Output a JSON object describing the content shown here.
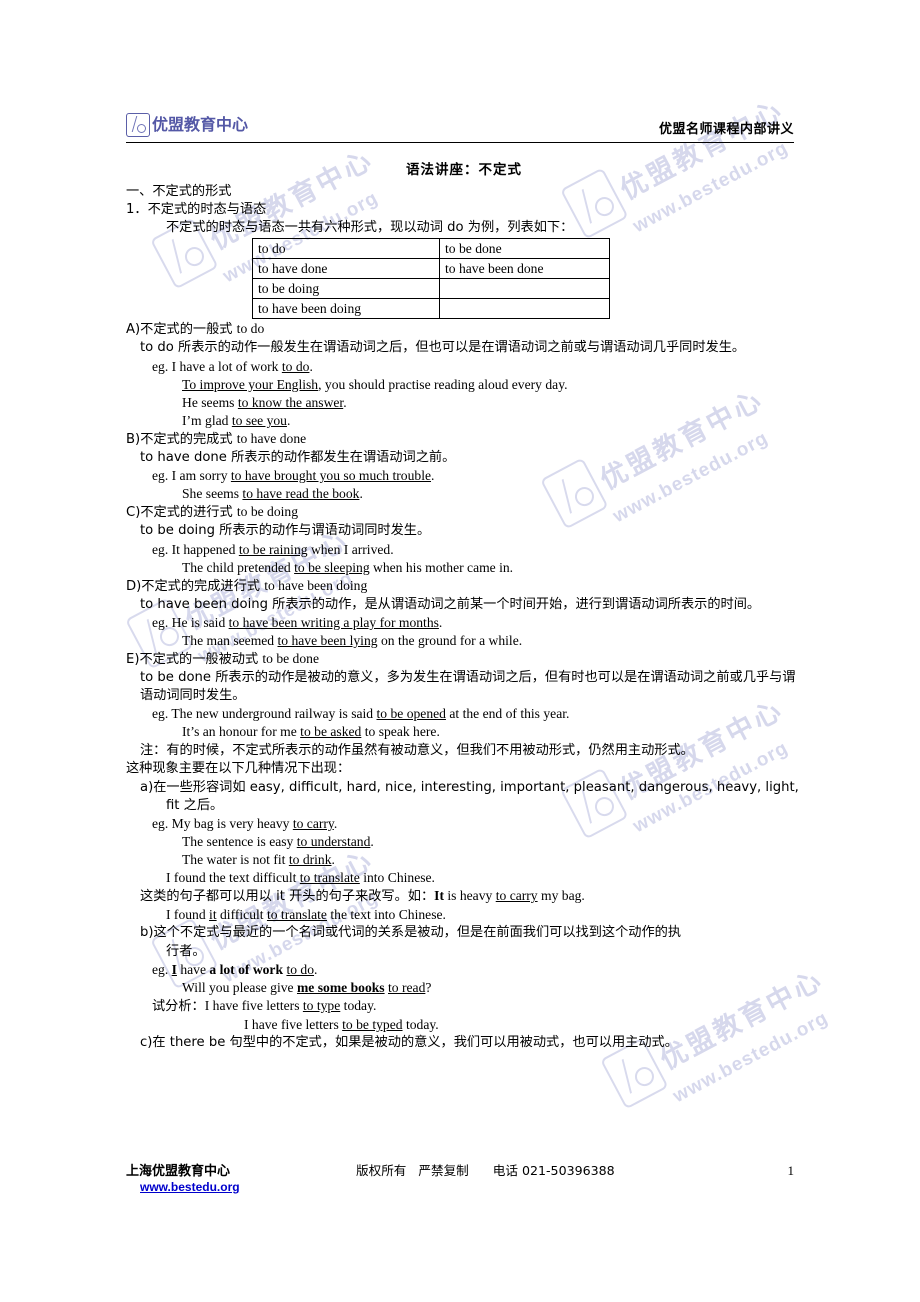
{
  "header": {
    "logo_text": "优盟教育中心",
    "logo_icon": "umeng-logo-icon",
    "right_title": "优盟名师课程内部讲义"
  },
  "doc": {
    "title": "语法讲座：不定式",
    "section1_heading": "一、不定式的形式",
    "item1_heading": "1．不定式的时态与语态",
    "item1_intro": "不定式的时态与语态一共有六种形式，现以动词 do 为例，列表如下：",
    "table": {
      "rows": [
        [
          "to do",
          "to be done"
        ],
        [
          "to have done",
          "to have been done"
        ],
        [
          "to be doing",
          ""
        ],
        [
          "to have been doing",
          ""
        ]
      ]
    },
    "blocks": [
      {
        "heading_cn": "A)不定式的一般式 ",
        "heading_en": "to do",
        "para": "to do 所表示的动作一般发生在谓语动词之后，但也可以是在谓语动词之前或与谓语动词几乎同时发生。",
        "examples": [
          {
            "prefix": "eg. I have a lot of work ",
            "u": "to do",
            "suffix": "."
          },
          {
            "prefix": "",
            "u": "To improve your English",
            "suffix": ", you should practise reading aloud every day."
          },
          {
            "prefix": "He seems ",
            "u": "to know the answer",
            "suffix": "."
          },
          {
            "prefix": "I’m glad ",
            "u": "to see you",
            "suffix": "."
          }
        ]
      },
      {
        "heading_cn": "B)不定式的完成式 ",
        "heading_en": "to have done",
        "para": "to have done 所表示的动作都发生在谓语动词之前。",
        "examples": [
          {
            "prefix": "eg. I am sorry ",
            "u": "to have brought you so much trouble",
            "suffix": "."
          },
          {
            "prefix": "She seems ",
            "u": "to have read the book",
            "suffix": "."
          }
        ]
      },
      {
        "heading_cn": "C)不定式的进行式 ",
        "heading_en": "to be doing",
        "para": "to be doing 所表示的动作与谓语动词同时发生。",
        "examples": [
          {
            "prefix": "eg. It happened ",
            "u": "to be raining",
            "suffix": " when I arrived."
          },
          {
            "prefix": "The child pretended ",
            "u": "to be sleeping",
            "suffix": " when his mother came in."
          }
        ]
      },
      {
        "heading_cn": "D)不定式的完成进行式 ",
        "heading_en": "to have been doing",
        "para": "to have been doing 所表示的动作，是从谓语动词之前某一个时间开始，进行到谓语动词所表示的时间。",
        "examples": [
          {
            "prefix": "eg. He is said ",
            "u": "to have been writing a play for months",
            "suffix": "."
          },
          {
            "prefix": "The man seemed ",
            "u": "to have been lying",
            "suffix": " on the ground for a while."
          }
        ]
      },
      {
        "heading_cn": "E)不定式的一般被动式 ",
        "heading_en": "to be done",
        "para": "to be done 所表示的动作是被动的意义，多为发生在谓语动词之后，但有时也可以是在谓语动词之前或几乎与谓语动词同时发生。",
        "examples": [
          {
            "prefix": "eg. The new underground railway is said ",
            "u": "to be opened",
            "suffix": " at the end of this year."
          },
          {
            "prefix": "It’s an honour for me ",
            "u": "to be asked",
            "suffix": " to speak here."
          }
        ]
      }
    ],
    "note_line1": "注：有的时候，不定式所表示的动作虽然有被动意义，但我们不用被动形式，仍然用主动形式。",
    "note_line2": "这种现象主要在以下几种情况下出现：",
    "sub_a": {
      "line1": "a)在一些形容词如 easy, difficult, hard, nice, interesting, important, pleasant, dangerous, heavy, light,",
      "line2": "fit 之后。",
      "examples": [
        {
          "prefix": "eg. My bag is very heavy ",
          "u": "to carry",
          "suffix": "."
        },
        {
          "prefix": "The sentence is easy ",
          "u": "to understand",
          "suffix": "."
        },
        {
          "prefix": "The water is not fit ",
          "u": "to drink",
          "suffix": "."
        },
        {
          "prefix": "I found the text difficult ",
          "u": "to translate",
          "suffix": " into Chinese."
        }
      ],
      "rewrite_cn": "这类的句子都可以用以 it 开头的句子来改写。如：",
      "rewrite_bold": "It",
      "rewrite_mid": " is heavy ",
      "rewrite_u": "to carry",
      "rewrite_tail": " my bag.",
      "last_prefix": "I found ",
      "last_u1": "it",
      "last_mid": " difficult ",
      "last_u2": "to translate",
      "last_tail": " the text into Chinese."
    },
    "sub_b": {
      "line1": "b)这个不定式与最近的一个名词或代词的关系是被动，但是在前面我们可以找到这个动作的执",
      "line2": "行者。",
      "ex1": {
        "prefix": "eg. ",
        "bu": "I",
        "mid1": " have ",
        "b": "a lot of work",
        "mid2": " ",
        "u": "to do",
        "suffix": "."
      },
      "ex2": {
        "prefix": "Will you please give ",
        "bu": "me some books",
        "mid": " ",
        "u": "to read",
        "suffix": "?"
      },
      "analysis_label": "试分析：",
      "analysis": [
        {
          "prefix": "I have five letters ",
          "u": "to type",
          "suffix": " today."
        },
        {
          "prefix": "I have five letters ",
          "u": "to be typed",
          "suffix": " today."
        }
      ]
    },
    "sub_c": "c)在 there be 句型中的不定式，如果是被动的意义，我们可以用被动式，也可以用主动式。"
  },
  "footer": {
    "org": "上海优盟教育中心",
    "url": "www.bestedu.org",
    "copyright": "版权所有   严禁复制      电话 021-50396388",
    "page_number": "1"
  },
  "watermark": {
    "cn_text": "优盟教育中心",
    "url_text": "www.bestedu.org",
    "color": "#b6b9de"
  },
  "colors": {
    "logo_blue": "#5458a6",
    "link_blue": "#0000cc",
    "rule_black": "#000000"
  }
}
